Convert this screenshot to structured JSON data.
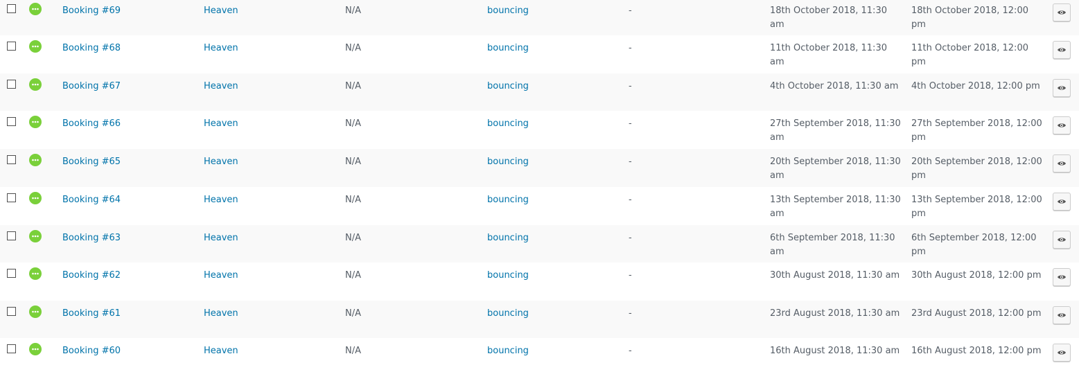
{
  "bookings": [
    {
      "id": "Booking #69",
      "product": "Heaven",
      "resource": "N/A",
      "person": "bouncing",
      "order": "-",
      "start": "18th October 2018, 11:30 am",
      "end": "18th October 2018, 12:00 pm"
    },
    {
      "id": "Booking #68",
      "product": "Heaven",
      "resource": "N/A",
      "person": "bouncing",
      "order": "-",
      "start": "11th October 2018, 11:30 am",
      "end": "11th October 2018, 12:00 pm"
    },
    {
      "id": "Booking #67",
      "product": "Heaven",
      "resource": "N/A",
      "person": "bouncing",
      "order": "-",
      "start": "4th October 2018, 11:30 am",
      "end": "4th October 2018, 12:00 pm"
    },
    {
      "id": "Booking #66",
      "product": "Heaven",
      "resource": "N/A",
      "person": "bouncing",
      "order": "-",
      "start": "27th September 2018, 11:30 am",
      "end": "27th September 2018, 12:00 pm"
    },
    {
      "id": "Booking #65",
      "product": "Heaven",
      "resource": "N/A",
      "person": "bouncing",
      "order": "-",
      "start": "20th September 2018, 11:30 am",
      "end": "20th September 2018, 12:00 pm"
    },
    {
      "id": "Booking #64",
      "product": "Heaven",
      "resource": "N/A",
      "person": "bouncing",
      "order": "-",
      "start": "13th September 2018, 11:30 am",
      "end": "13th September 2018, 12:00 pm"
    },
    {
      "id": "Booking #63",
      "product": "Heaven",
      "resource": "N/A",
      "person": "bouncing",
      "order": "-",
      "start": "6th September 2018, 11:30 am",
      "end": "6th September 2018, 12:00 pm"
    },
    {
      "id": "Booking #62",
      "product": "Heaven",
      "resource": "N/A",
      "person": "bouncing",
      "order": "-",
      "start": "30th August 2018, 11:30 am",
      "end": "30th August 2018, 12:00 pm"
    },
    {
      "id": "Booking #61",
      "product": "Heaven",
      "resource": "N/A",
      "person": "bouncing",
      "order": "-",
      "start": "23rd August 2018, 11:30 am",
      "end": "23rd August 2018, 12:00 pm"
    },
    {
      "id": "Booking #60",
      "product": "Heaven",
      "resource": "N/A",
      "person": "bouncing",
      "order": "-",
      "start": "16th August 2018, 11:30 am",
      "end": "16th August 2018, 12:00 pm"
    }
  ],
  "status_icon": "ellipsis-icon",
  "view_icon": "eye-icon",
  "colors": {
    "status_green": "#7ad03a",
    "link": "#0073aa",
    "text": "#555d66",
    "row_alt": "#f9f9f9"
  }
}
